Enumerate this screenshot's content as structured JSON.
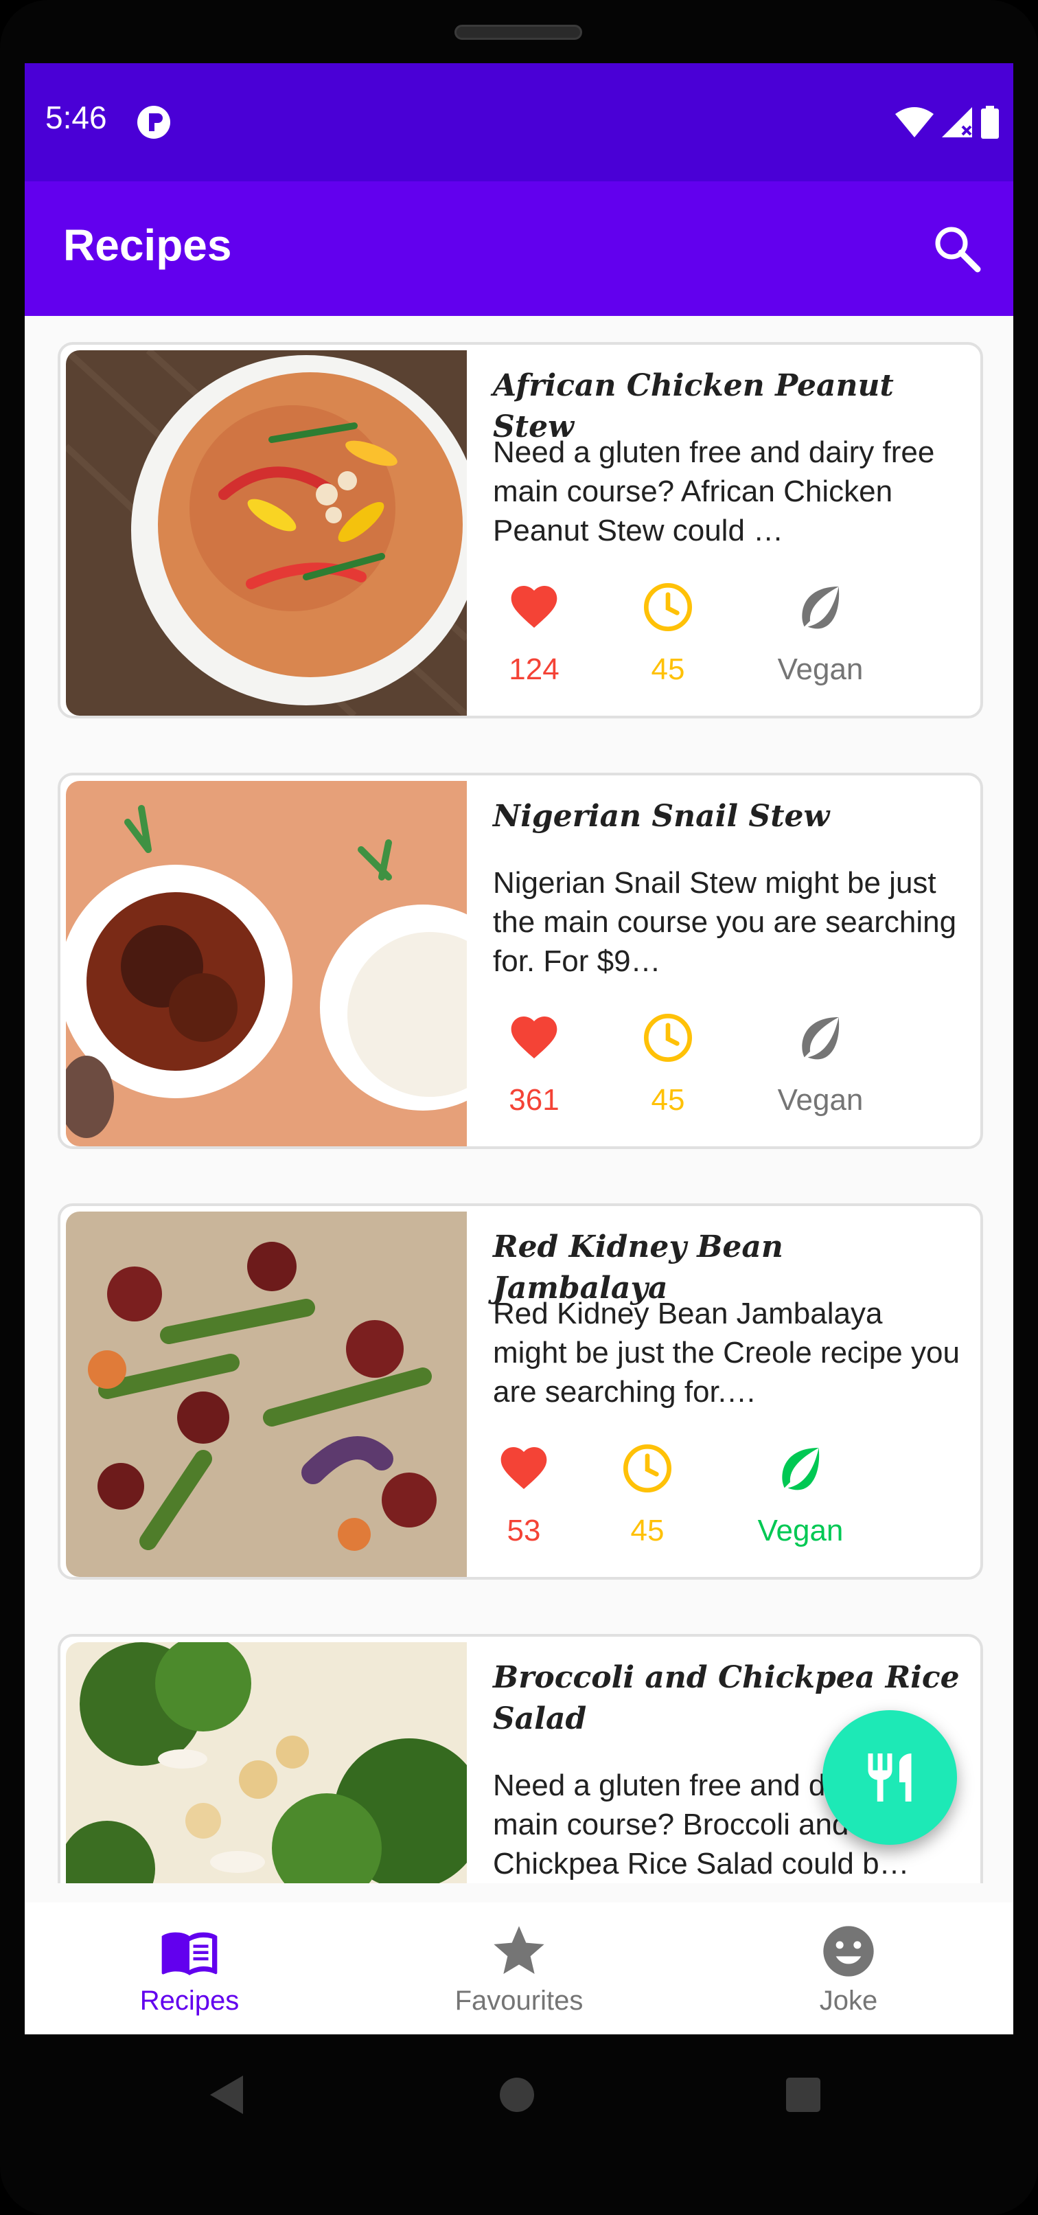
{
  "status_bar": {
    "time": "5:46"
  },
  "app_bar": {
    "title": "Recipes",
    "search_icon": "search-icon"
  },
  "recipes": [
    {
      "title": "African Chicken Peanut Stew",
      "description": "Need a gluten free and dairy free main course? African Chicken Peanut Stew could …",
      "likes": "124",
      "minutes": "45",
      "vegan_label": "Vegan",
      "is_vegan": false
    },
    {
      "title": "Nigerian Snail Stew",
      "description": "Nigerian Snail Stew might be just the main course you are searching for. For $9…",
      "likes": "361",
      "minutes": "45",
      "vegan_label": "Vegan",
      "is_vegan": false
    },
    {
      "title": "Red Kidney Bean Jambalaya",
      "description": "Red Kidney Bean Jambalaya might be just the Creole recipe you are searching for.…",
      "likes": "53",
      "minutes": "45",
      "vegan_label": "Vegan",
      "is_vegan": true
    },
    {
      "title": "Broccoli and Chickpea Rice Salad",
      "description": "Need a gluten free and dairy free main course? Broccoli and Chickpea Rice Salad could b…",
      "likes": "",
      "minutes": "",
      "vegan_label": "",
      "is_vegan": true
    }
  ],
  "fab": {
    "icon": "restaurant-icon"
  },
  "bottom_nav": {
    "items": [
      {
        "label": "Recipes",
        "icon": "menu-book-icon",
        "selected": true
      },
      {
        "label": "Favourites",
        "icon": "star-icon",
        "selected": false
      },
      {
        "label": "Joke",
        "icon": "smiley-icon",
        "selected": false
      }
    ]
  },
  "colors": {
    "primary": "#6200ee",
    "primary_dark": "#4a00d6",
    "accent": "#1de9b6",
    "like_red": "#f44336",
    "time_yellow": "#ffc107",
    "vegan_green": "#00c853",
    "inactive_gray": "#757575"
  }
}
